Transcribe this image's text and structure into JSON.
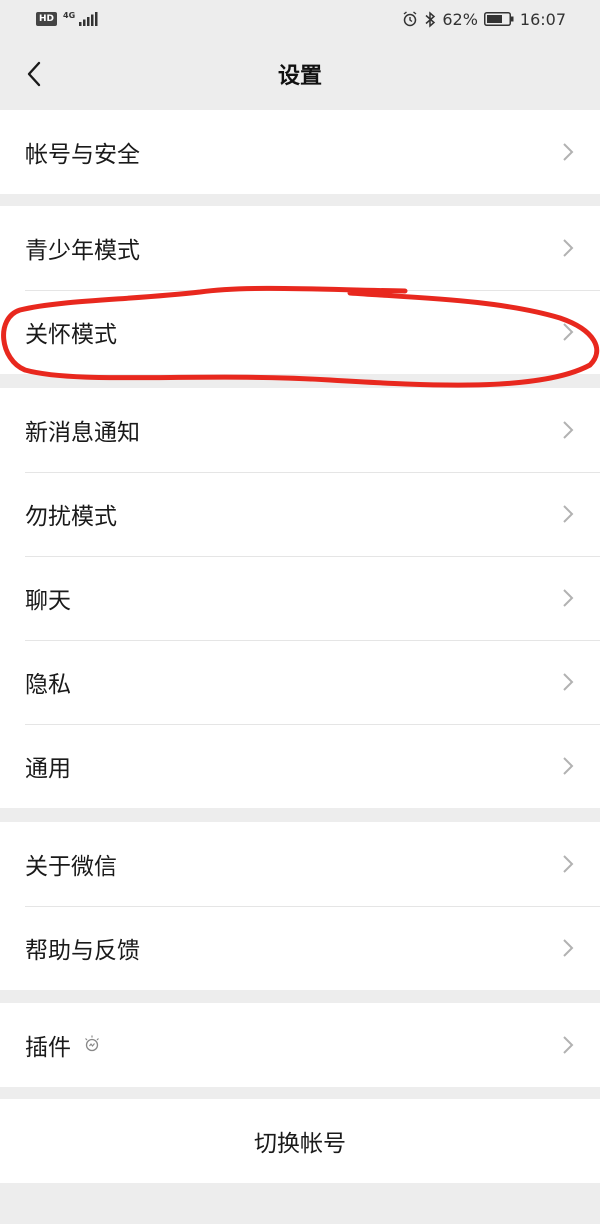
{
  "status_bar": {
    "hd": "HD",
    "network": "4G",
    "battery_percent": "62%",
    "time": "16:07",
    "icons": [
      "signal-icon",
      "alarm-icon",
      "bluetooth-icon",
      "battery-icon"
    ]
  },
  "nav": {
    "title": "设置"
  },
  "groups": {
    "account": {
      "account_security": "帐号与安全"
    },
    "modes": {
      "teen_mode": "青少年模式",
      "care_mode": "关怀模式"
    },
    "general": {
      "notifications": "新消息通知",
      "do_not_disturb": "勿扰模式",
      "chat": "聊天",
      "privacy": "隐私",
      "general": "通用"
    },
    "about": {
      "about_wechat": "关于微信",
      "help_feedback": "帮助与反馈"
    },
    "plugins": {
      "plugins": "插件"
    },
    "switch": {
      "switch_account": "切换帐号"
    }
  },
  "colors": {
    "background": "#ededed",
    "card": "#ffffff",
    "annotation_stroke": "#e8281e",
    "chevron": "#b2b2b2"
  }
}
